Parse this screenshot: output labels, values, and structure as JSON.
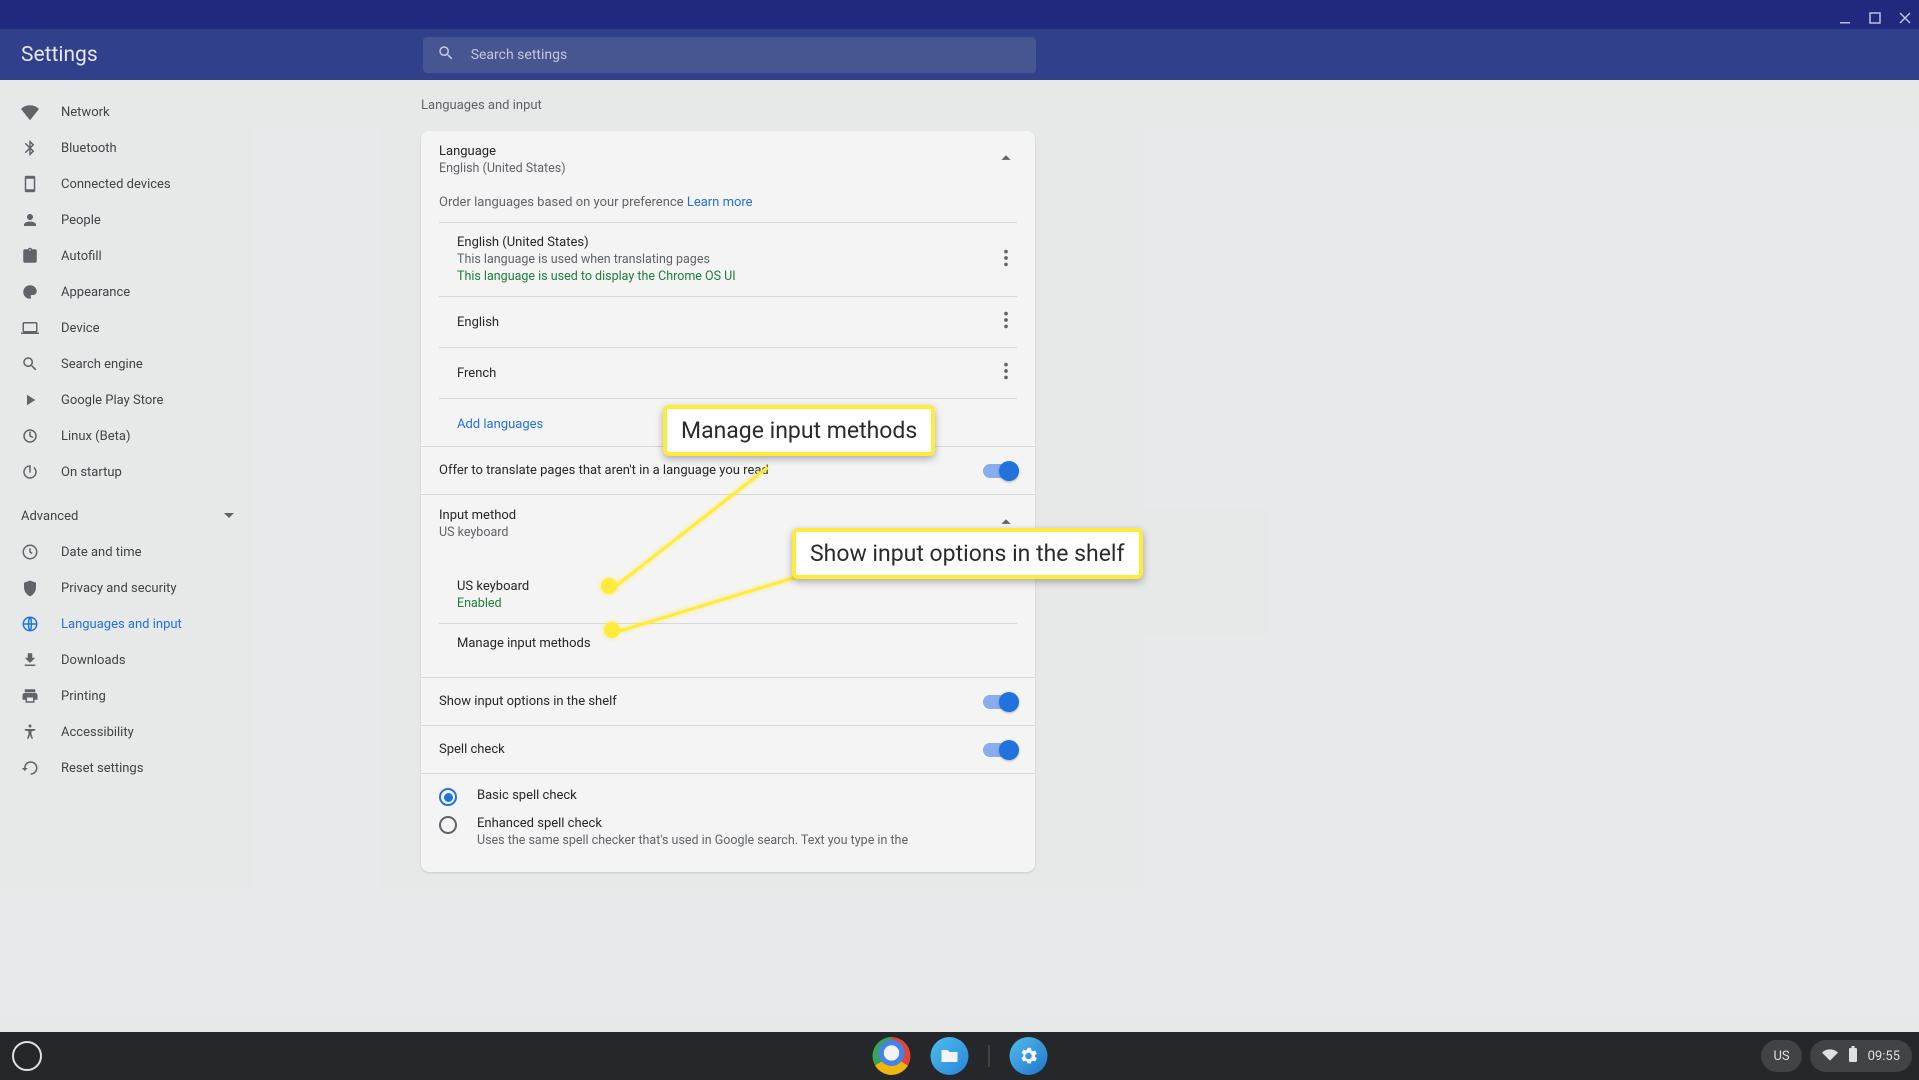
{
  "header": {
    "title": "Settings",
    "search_placeholder": "Search settings"
  },
  "sidebar": {
    "items": [
      {
        "label": "Network"
      },
      {
        "label": "Bluetooth"
      },
      {
        "label": "Connected devices"
      },
      {
        "label": "People"
      },
      {
        "label": "Autofill"
      },
      {
        "label": "Appearance"
      },
      {
        "label": "Device"
      },
      {
        "label": "Search engine"
      },
      {
        "label": "Google Play Store"
      },
      {
        "label": "Linux (Beta)"
      },
      {
        "label": "On startup"
      }
    ],
    "advanced_label": "Advanced",
    "advanced_items": [
      {
        "label": "Date and time"
      },
      {
        "label": "Privacy and security"
      },
      {
        "label": "Languages and input"
      },
      {
        "label": "Downloads"
      },
      {
        "label": "Printing"
      },
      {
        "label": "Accessibility"
      },
      {
        "label": "Reset settings"
      }
    ]
  },
  "main": {
    "section_title": "Languages and input",
    "language": {
      "title": "Language",
      "subtitle": "English (United States)",
      "order_text": "Order languages based on your preference",
      "learn_more": "Learn more",
      "items": [
        {
          "name": "English (United States)",
          "sub1": "This language is used when translating pages",
          "sub2": "This language is used to display the Chrome OS UI"
        },
        {
          "name": "English"
        },
        {
          "name": "French"
        }
      ],
      "add": "Add languages",
      "translate": "Offer to translate pages that aren't in a language you read"
    },
    "input": {
      "title": "Input method",
      "subtitle": "US keyboard",
      "kb_name": "US keyboard",
      "kb_status": "Enabled",
      "manage": "Manage input methods",
      "show_shelf": "Show input options in the shelf"
    },
    "spell": {
      "title": "Spell check",
      "basic": "Basic spell check",
      "enhanced": "Enhanced spell check",
      "enhanced_sub": "Uses the same spell checker that's used in Google search. Text you type in the"
    }
  },
  "callouts": {
    "c1": "Manage input methods",
    "c2": "Show input options in the shelf"
  },
  "shelf": {
    "lang": "US",
    "time": "09:55"
  }
}
